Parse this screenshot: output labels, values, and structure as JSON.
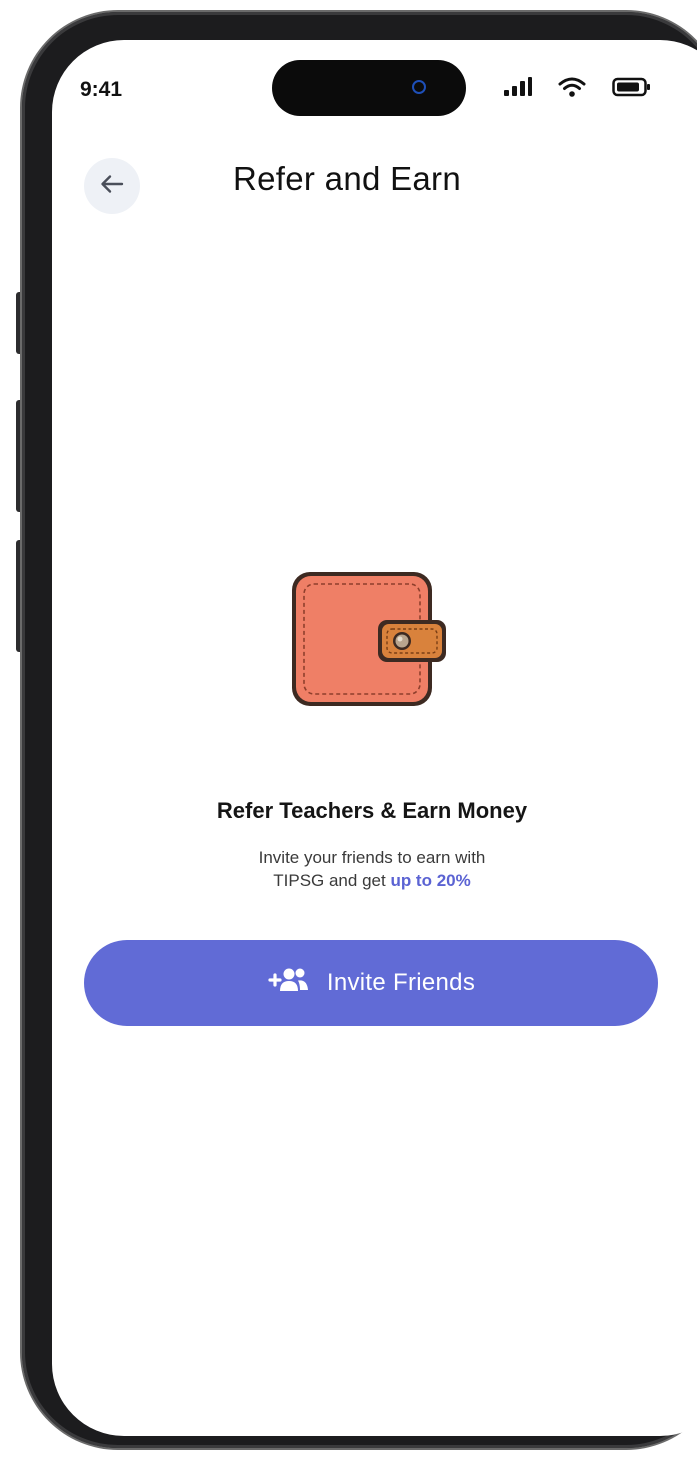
{
  "status_bar": {
    "time": "9:41",
    "icons": [
      "signal-icon",
      "wifi-icon",
      "battery-icon"
    ]
  },
  "header": {
    "back_icon": "arrow-left-icon",
    "title": "Refer and Earn"
  },
  "hero": {
    "illustration": "wallet-icon",
    "headline": "Refer Teachers & Earn Money",
    "description_line1": "Invite your friends to earn with",
    "description_line2_prefix": "TIPSG and get ",
    "description_highlight": "up to 20%"
  },
  "cta": {
    "icon": "add-users-icon",
    "label": "Invite Friends"
  },
  "colors": {
    "accent": "#616bd6",
    "highlight_text": "#5b63d3",
    "wallet_body": "#ef7f66",
    "wallet_strap": "#d9823c",
    "back_button_bg": "#eef1f6"
  }
}
